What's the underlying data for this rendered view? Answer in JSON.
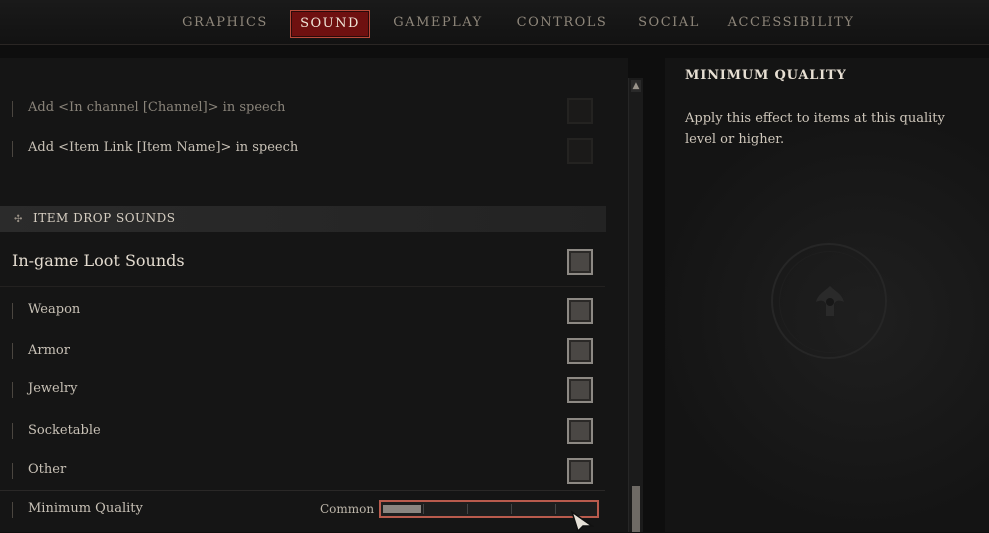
{
  "nav": {
    "tabs": [
      "GRAPHICS",
      "SOUND",
      "GAMEPLAY",
      "CONTROLS",
      "SOCIAL",
      "ACCESSIBILITY"
    ],
    "active": "SOUND"
  },
  "speech_rows": [
    {
      "label": "Add <In channel [Channel]> in speech",
      "checked": false
    },
    {
      "label": "Add <Item Link [Item Name]> in speech",
      "checked": false
    }
  ],
  "section": {
    "icon": "diamond-icon",
    "title": "ITEM DROP SOUNDS"
  },
  "loot": {
    "label": "In-game Loot Sounds",
    "checked": true
  },
  "loot_rows": [
    {
      "label": "Weapon",
      "checked": true
    },
    {
      "label": "Armor",
      "checked": true
    },
    {
      "label": "Jewelry",
      "checked": true
    },
    {
      "label": "Socketable",
      "checked": true
    },
    {
      "label": "Other",
      "checked": true
    }
  ],
  "minimum_quality": {
    "label": "Minimum Quality",
    "value_label": "Common",
    "level": 1,
    "levels_total": 5
  },
  "info_panel": {
    "title": "MINIMUM QUALITY",
    "description": "Apply this effect to items at this quality level or higher."
  },
  "colors": {
    "accent": "#6e1010",
    "accent_border": "#b84a3a"
  }
}
